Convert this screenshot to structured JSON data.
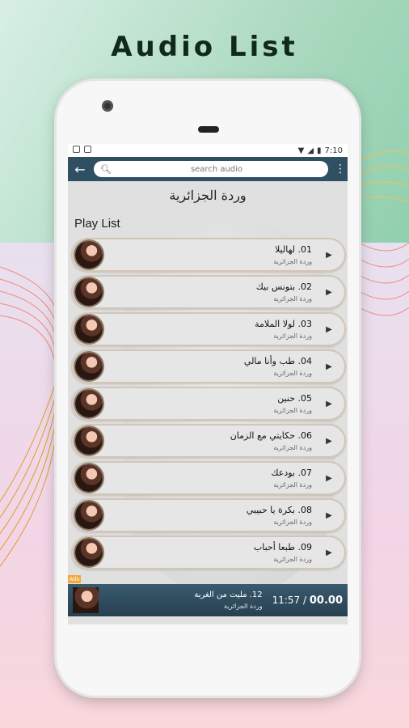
{
  "headline": "Audio List",
  "status_bar": {
    "time": "7:10"
  },
  "toolbar": {
    "search_placeholder": "search audio"
  },
  "artist_title": "وردة الجزائرية",
  "section_title": "Play List",
  "tracks": [
    {
      "name": "01. لهاليلا",
      "artist": "وردة الجزائرية"
    },
    {
      "name": "02. بتونس بيك",
      "artist": "وردة الجزائرية"
    },
    {
      "name": "03. لولا الملامة",
      "artist": "وردة الجزائرية"
    },
    {
      "name": "04. طب وأنا مالي",
      "artist": "وردة الجزائرية"
    },
    {
      "name": "05. حنين",
      "artist": "وردة الجزائرية"
    },
    {
      "name": "06. حكايتي مع الزمان",
      "artist": "وردة الجزائرية"
    },
    {
      "name": "07. بودعك",
      "artist": "وردة الجزائرية"
    },
    {
      "name": "08. بكرة يا حبيبي",
      "artist": "وردة الجزائرية"
    },
    {
      "name": "09. طبعا أحباب",
      "artist": "وردة الجزائرية"
    }
  ],
  "ads_label": "Ads",
  "now_playing": {
    "name": "12. مليت من الغربة",
    "artist": "وردة الجزائرية",
    "elapsed": "00.00",
    "separator": "/",
    "duration": "11:57"
  },
  "colors": {
    "toolbar": "#2f4f63",
    "player": "#2e4b5e",
    "headline": "#11291a"
  }
}
